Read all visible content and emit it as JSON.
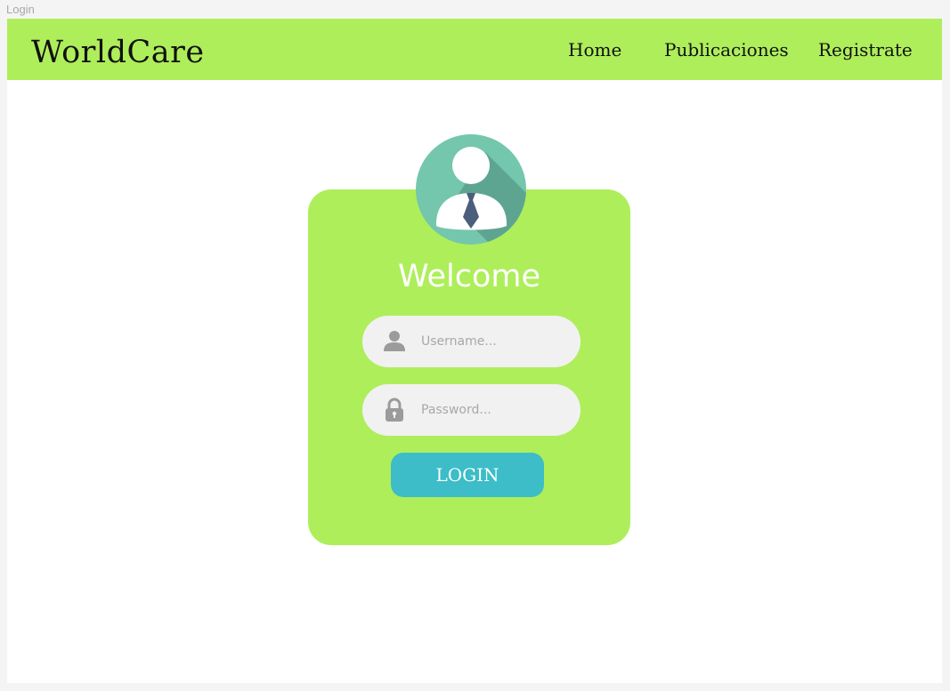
{
  "window": {
    "title": "Login"
  },
  "navbar": {
    "brand": "WorldCare",
    "links": [
      {
        "label": "Home"
      },
      {
        "label": "Publicaciones"
      },
      {
        "label": "Registrate"
      }
    ],
    "background": "#aeee5b"
  },
  "login_card": {
    "avatar_icon": "user-with-tie-icon",
    "heading": "Welcome",
    "username": {
      "icon": "user-icon",
      "placeholder": "Username...",
      "value": ""
    },
    "password": {
      "icon": "lock-icon",
      "placeholder": "Password...",
      "value": ""
    },
    "submit_label": "LOGIN",
    "colors": {
      "card": "#aeee5b",
      "button": "#3cbdc7",
      "avatar": "#74c6ad"
    }
  }
}
